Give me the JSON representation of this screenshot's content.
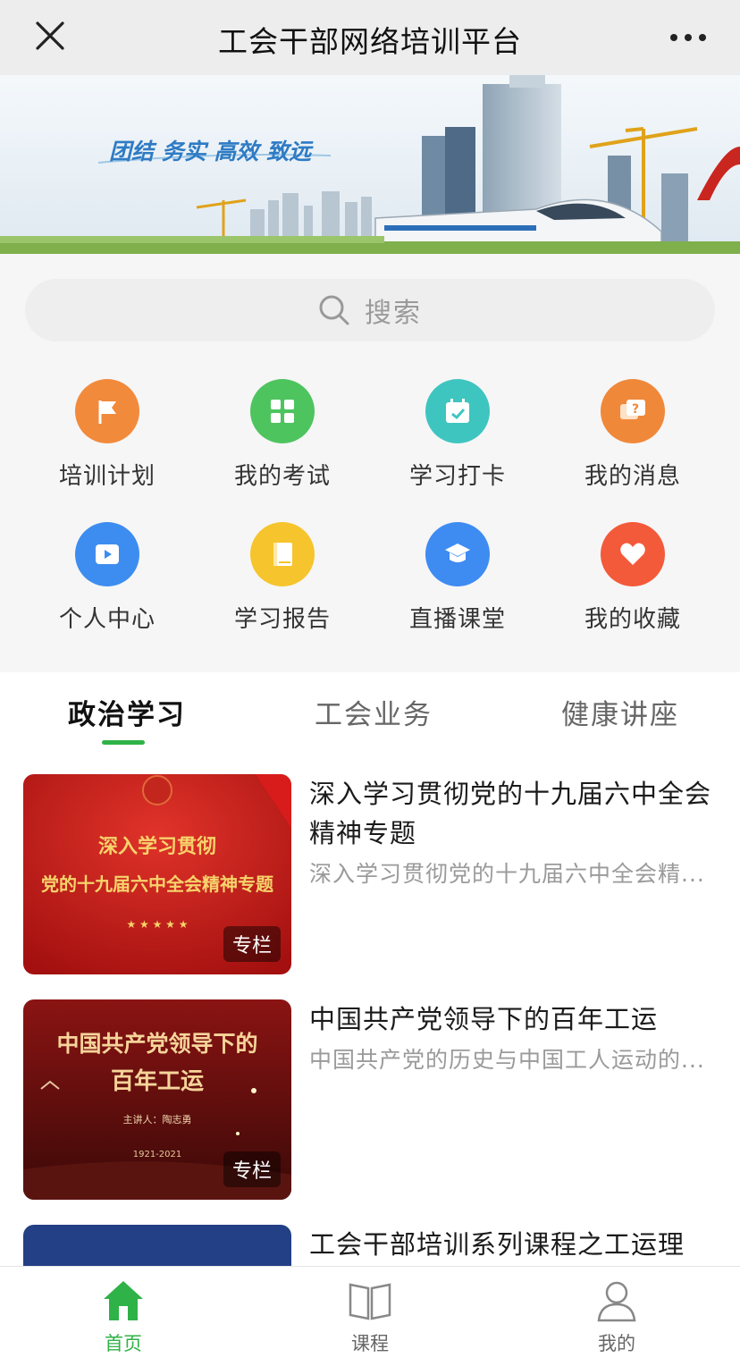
{
  "header": {
    "title": "工会干部网络培训平台",
    "close_icon": "close-icon",
    "more_icon": "more-icon"
  },
  "banner": {
    "slogan": "团结 务实 高效 致远"
  },
  "search": {
    "placeholder": "搜索",
    "icon": "search-icon"
  },
  "shortcuts": [
    {
      "label": "培训计划",
      "icon": "flag-icon",
      "color": "#f28a3c"
    },
    {
      "label": "我的考试",
      "icon": "grid-icon",
      "color": "#4ec45f"
    },
    {
      "label": "学习打卡",
      "icon": "calendar-check-icon",
      "color": "#3fc5c0"
    },
    {
      "label": "我的消息",
      "icon": "message-question-icon",
      "color": "#f0883a"
    },
    {
      "label": "个人中心",
      "icon": "play-video-icon",
      "color": "#3d8df0"
    },
    {
      "label": "学习报告",
      "icon": "book-icon",
      "color": "#f6c42c"
    },
    {
      "label": "直播课堂",
      "icon": "graduation-cap-icon",
      "color": "#3e8bf2"
    },
    {
      "label": "我的收藏",
      "icon": "heart-icon",
      "color": "#f35a3a"
    }
  ],
  "tabs": [
    {
      "label": "政治学习",
      "active": true
    },
    {
      "label": "工会业务",
      "active": false
    },
    {
      "label": "健康讲座",
      "active": false
    }
  ],
  "courses": [
    {
      "title": "深入学习贯彻党的十九届六中全会精神专题",
      "desc": "深入学习贯彻党的十九届六中全会精...",
      "tag": "专栏",
      "thumb_line1": "深入学习贯彻",
      "thumb_line2": "党的十九届六中全会精神专题"
    },
    {
      "title": "中国共产党领导下的百年工运",
      "desc": "中国共产党的历史与中国工人运动的...",
      "tag": "专栏",
      "thumb_line1": "中国共产党领导下的",
      "thumb_line2": "百年工运",
      "thumb_speaker": "主讲人：陶志勇",
      "thumb_years": "1921-2021"
    },
    {
      "title": "工会干部培训系列课程之工运理"
    }
  ],
  "bottom_nav": [
    {
      "label": "首页",
      "icon": "home-icon",
      "active": true
    },
    {
      "label": "课程",
      "icon": "book-open-icon",
      "active": false
    },
    {
      "label": "我的",
      "icon": "user-icon",
      "active": false
    }
  ],
  "colors": {
    "accent": "#2fb247",
    "header_bg": "#ededed"
  }
}
